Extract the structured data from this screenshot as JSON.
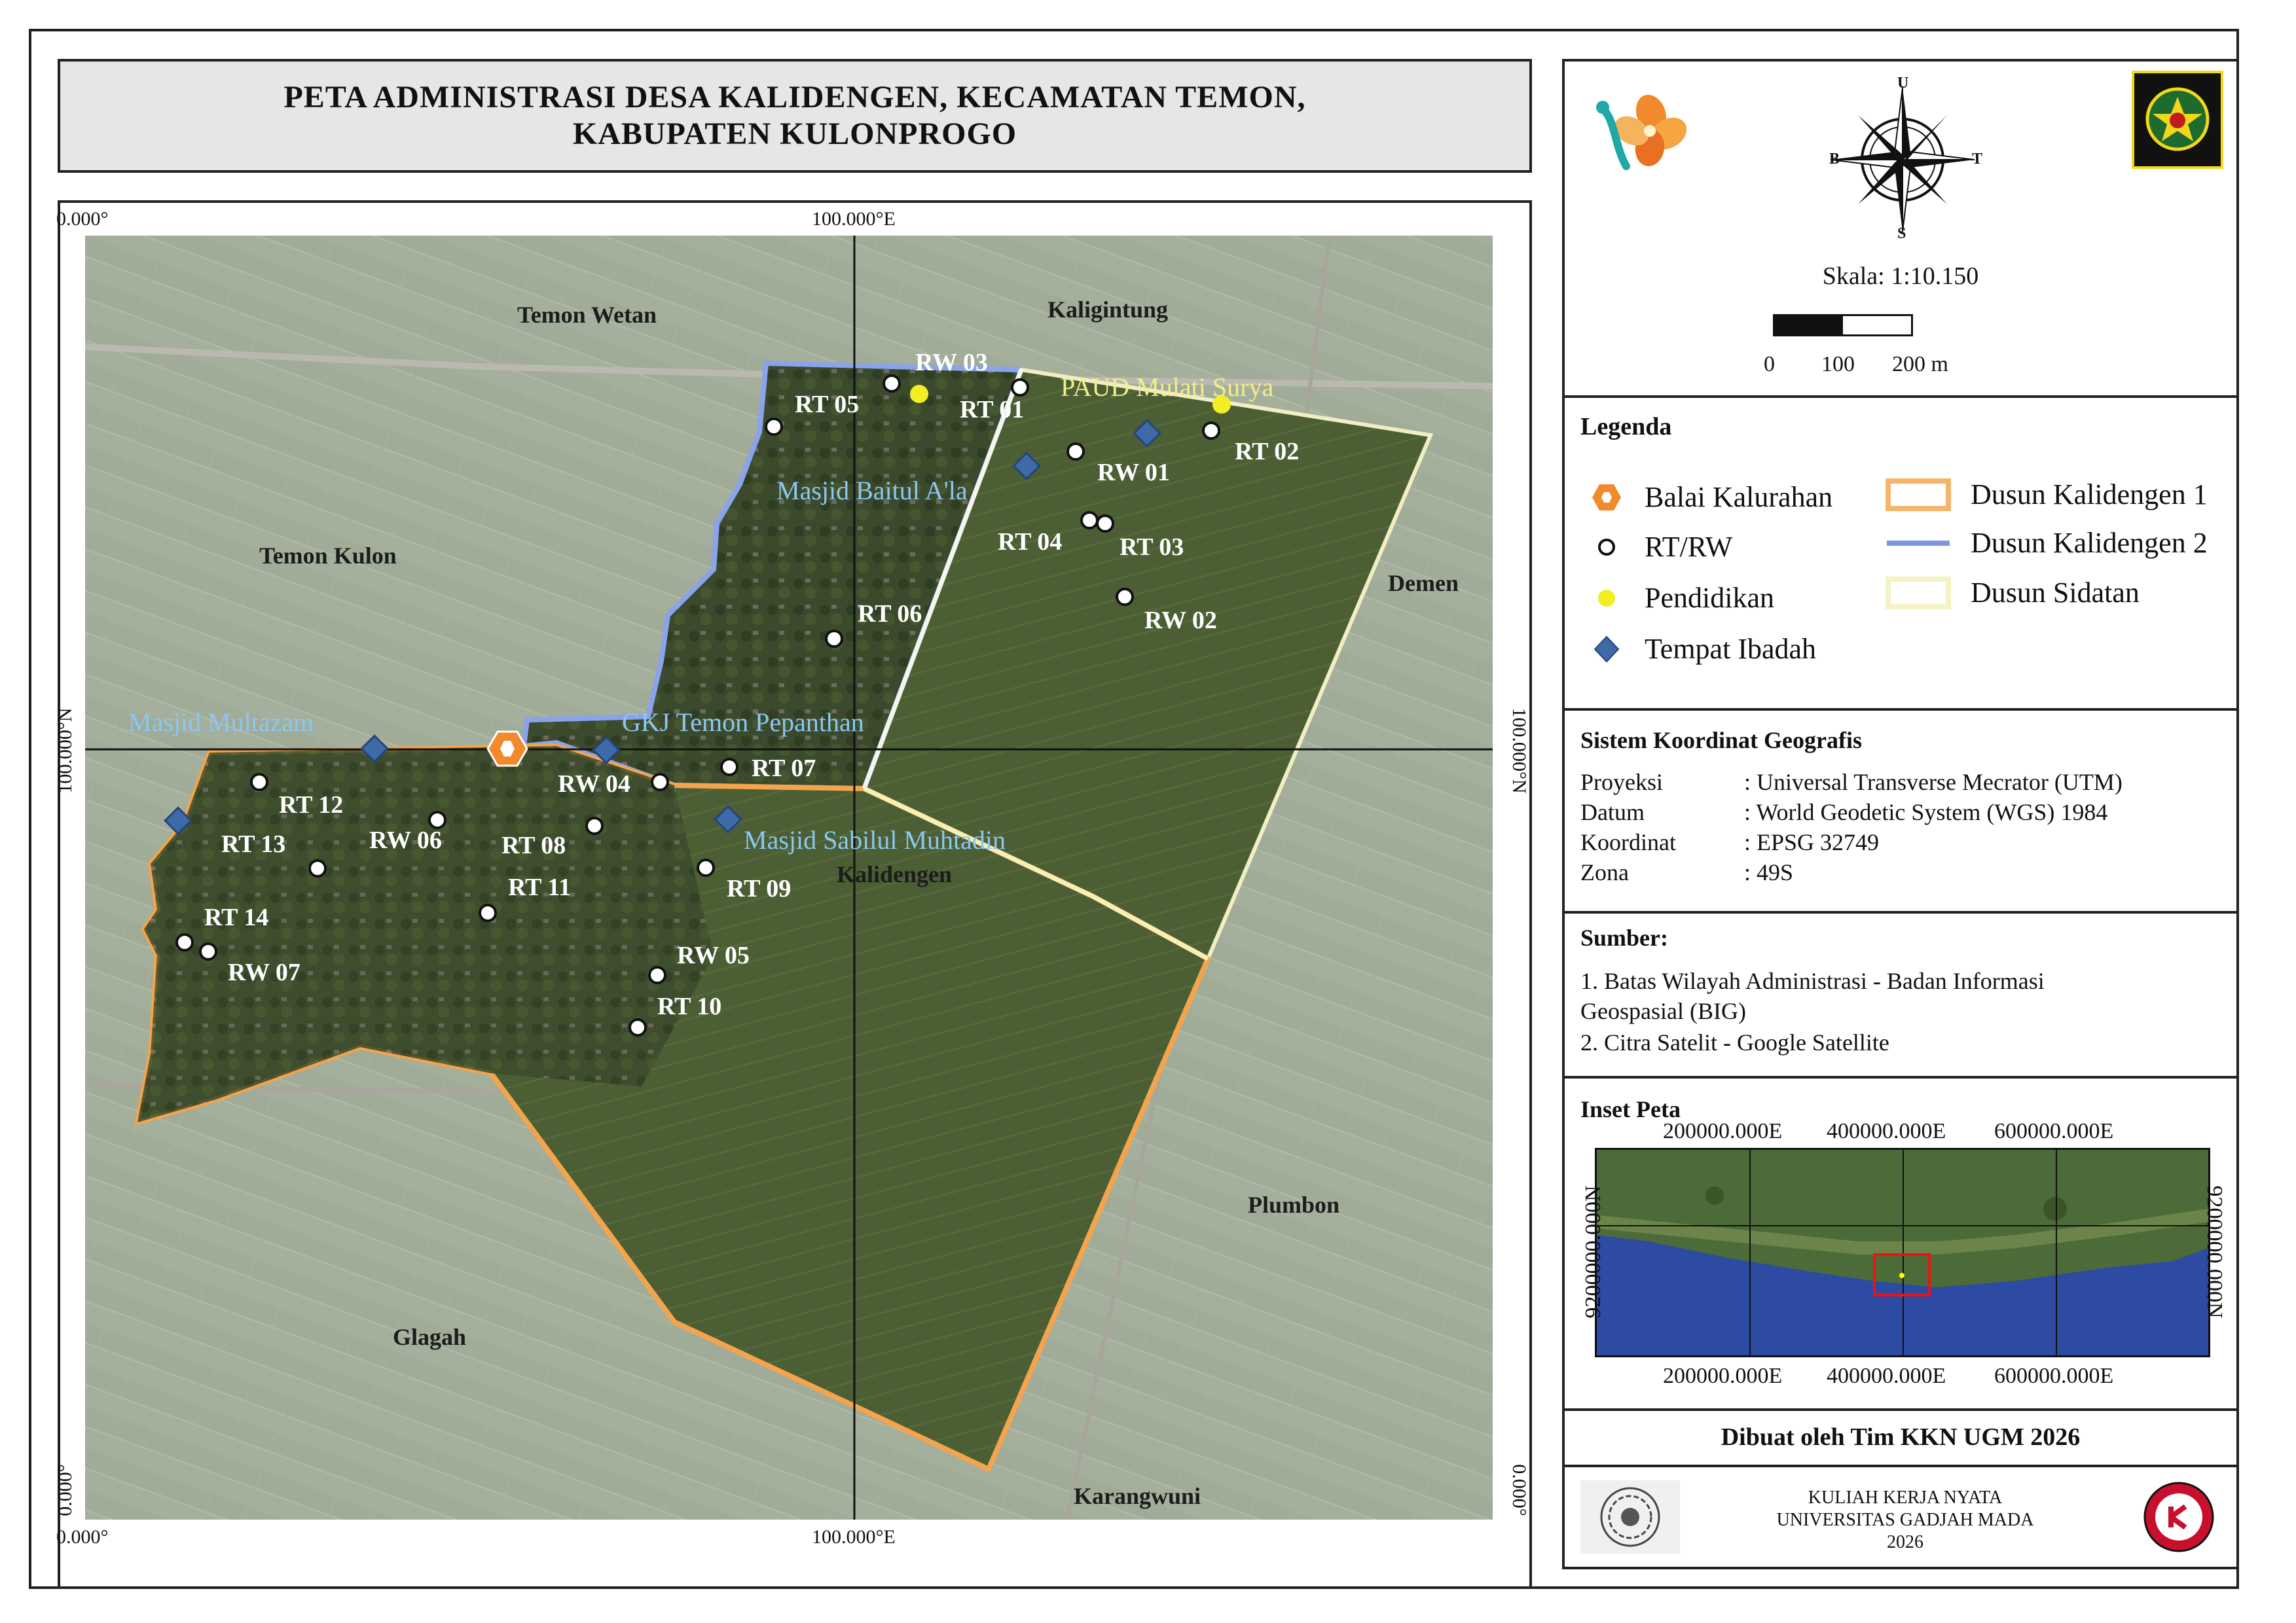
{
  "title": {
    "line1": "PETA ADMINISTRASI DESA KALIDENGEN, KECAMATAN TEMON,",
    "line2": "KABUPATEN KULONPROGO"
  },
  "grid": {
    "top_left": "0.000°",
    "top_mid": "100.000°E",
    "bottom_left": "0.000°",
    "bottom_mid": "100.000°E",
    "left_mid": "100.000°N",
    "right_mid": "100.000°N",
    "left_bottom": "0.000°",
    "right_bottom": "0.000°"
  },
  "villages": [
    "Temon Wetan",
    "Kaligintung",
    "Temon Kulon",
    "Demen",
    "Kalidengen",
    "Plumbon",
    "Glagah",
    "Karangwuni"
  ],
  "points": {
    "rt_rw": [
      "RW 03",
      "RT 05",
      "RT 01",
      "RT 02",
      "RW 01",
      "RT 04",
      "RT 03",
      "RW 02",
      "RT 06",
      "RT 07",
      "RW 04",
      "RT 12",
      "RT 13",
      "RW 06",
      "RT 08",
      "RT 11",
      "RT 09",
      "RT 14",
      "RW 07",
      "RW 05",
      "RT 10"
    ],
    "worship": [
      "Masjid Baitul A'la",
      "Masjid Multazam",
      "GKJ Temon Pepanthan",
      "Masjid Sabilul Muhtadin"
    ],
    "education": [
      "PAUD Mulati Surya"
    ]
  },
  "panel": {
    "compass": {
      "n": "U",
      "s": "S",
      "e": "T",
      "w": "B"
    },
    "scale_text": "Skala: 1:10.150",
    "scale_ticks": [
      "0",
      "100",
      "200 m"
    ],
    "legend_title": "Legenda",
    "legend": [
      {
        "label": "Balai Kalurahan",
        "icon": "hexagon-icon",
        "color": "#f08a2c"
      },
      {
        "label": "RT/RW",
        "icon": "circle-icon",
        "color": "#ffffff"
      },
      {
        "label": "Pendidikan",
        "icon": "dot-icon",
        "color": "#f2ee23"
      },
      {
        "label": "Tempat Ibadah",
        "icon": "diamond-icon",
        "color": "#3e6aa8"
      },
      {
        "label": "Dusun Kalidengen 1",
        "icon": "orange-rect-icon",
        "color": "#f6b46b"
      },
      {
        "label": "Dusun Kalidengen 2",
        "icon": "blue-line-icon",
        "color": "#7b96e2"
      },
      {
        "label": "Dusun Sidatan",
        "icon": "cream-rect-icon",
        "color": "#f7f2c4"
      }
    ],
    "crs_title": "Sistem Koordinat Geografis",
    "crs": [
      {
        "k": "Proyeksi",
        "v": ": Universal Transverse Mecrator (UTM)"
      },
      {
        "k": "Datum",
        "v": ": World Geodetic System (WGS) 1984"
      },
      {
        "k": "Koordinat",
        "v": ": EPSG 32749"
      },
      {
        "k": "Zona",
        "v": ": 49S"
      }
    ],
    "source_title": "Sumber:",
    "source_1a": "1. Batas Wilayah Administrasi - Badan Informasi",
    "source_1b": "Geospasial (BIG)",
    "source_2": "2. Citra Satelit - Google Satellite",
    "inset_title": "Inset Peta",
    "inset_top_ticks": [
      "200000.000E",
      "400000.000E",
      "600000.000E"
    ],
    "inset_bottom_ticks": [
      "200000.000E",
      "400000.000E",
      "600000.000E"
    ],
    "inset_left": "9200000.000N",
    "inset_right": "9200000.000N",
    "made_by": "Dibuat oleh Tim KKN UGM 2026",
    "footer_1": "KULIAH KERJA NYATA",
    "footer_2": "UNIVERSITAS GADJAH MADA",
    "footer_3": "2026"
  }
}
